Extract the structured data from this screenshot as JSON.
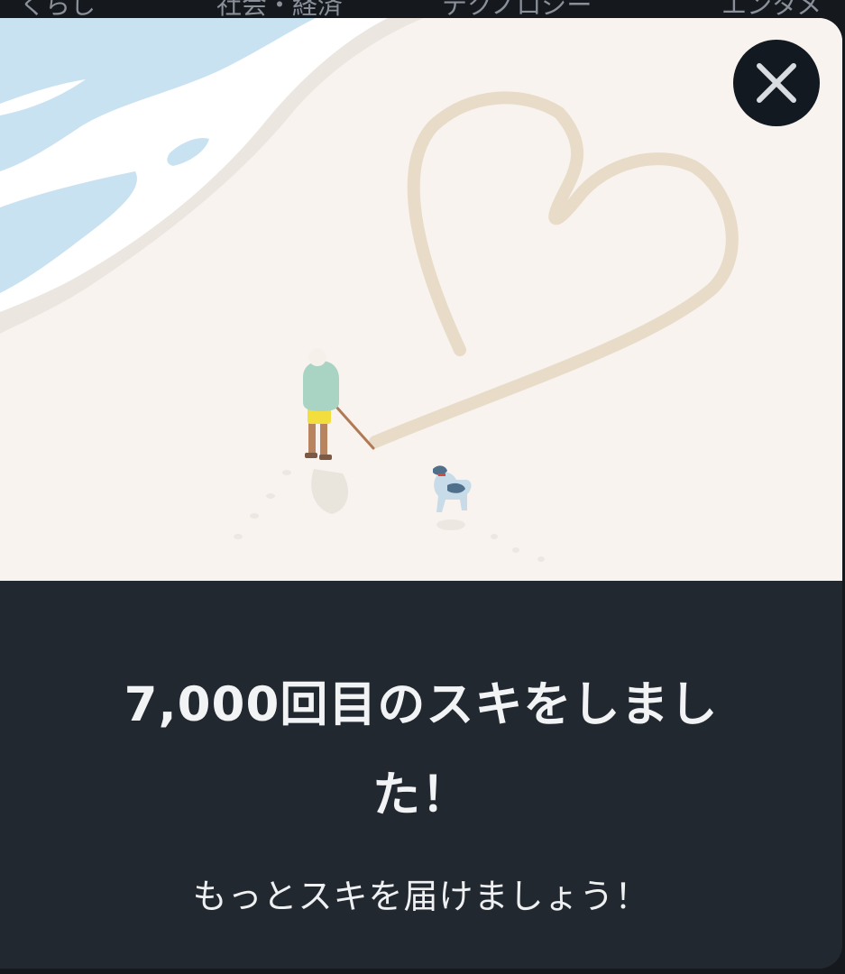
{
  "background_nav": {
    "tabs": [
      "くらし",
      "社会・経済",
      "テクノロジー",
      "エンタメ"
    ]
  },
  "modal": {
    "close_label": "閉じる",
    "title": "7,000回目のスキをしました！",
    "subtitle": "もっとスキを届けましょう！"
  },
  "colors": {
    "illustration_bg": "#f8f3ef",
    "panel_bg": "#222830",
    "sea": "#c9e2f2",
    "heart_sand": "#e8dcc8",
    "close_button_bg": "#121920"
  },
  "icons": {
    "close": "close-icon"
  }
}
